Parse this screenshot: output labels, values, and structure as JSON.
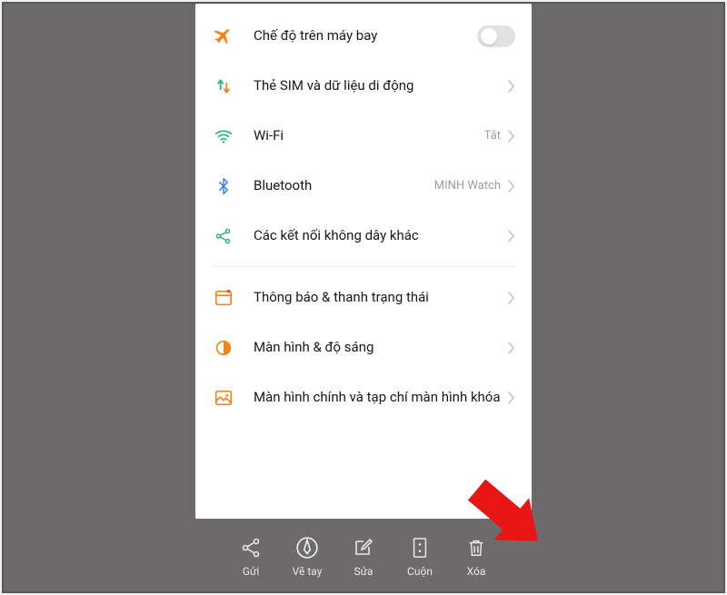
{
  "settings": {
    "rows": [
      {
        "label": "Chế độ trên máy bay"
      },
      {
        "label": "Thẻ SIM và dữ liệu di động"
      },
      {
        "label": "Wi-Fi",
        "value": "Tắt"
      },
      {
        "label": "Bluetooth",
        "value": "MINH Watch"
      },
      {
        "label": "Các kết nối không dây khác"
      },
      {
        "label": "Thông báo & thanh trạng thái"
      },
      {
        "label": "Màn hình & độ sáng"
      },
      {
        "label": "Màn hình chính và tạp chí màn hình khóa"
      }
    ]
  },
  "toolbar": {
    "send": "Gửi",
    "draw": "Vẽ tay",
    "edit": "Sửa",
    "scroll": "Cuộn",
    "delete": "Xóa"
  },
  "colors": {
    "accent": "#f0851e",
    "green": "#2fb37a",
    "blue": "#3b82f6",
    "arrow": "#e81515"
  }
}
